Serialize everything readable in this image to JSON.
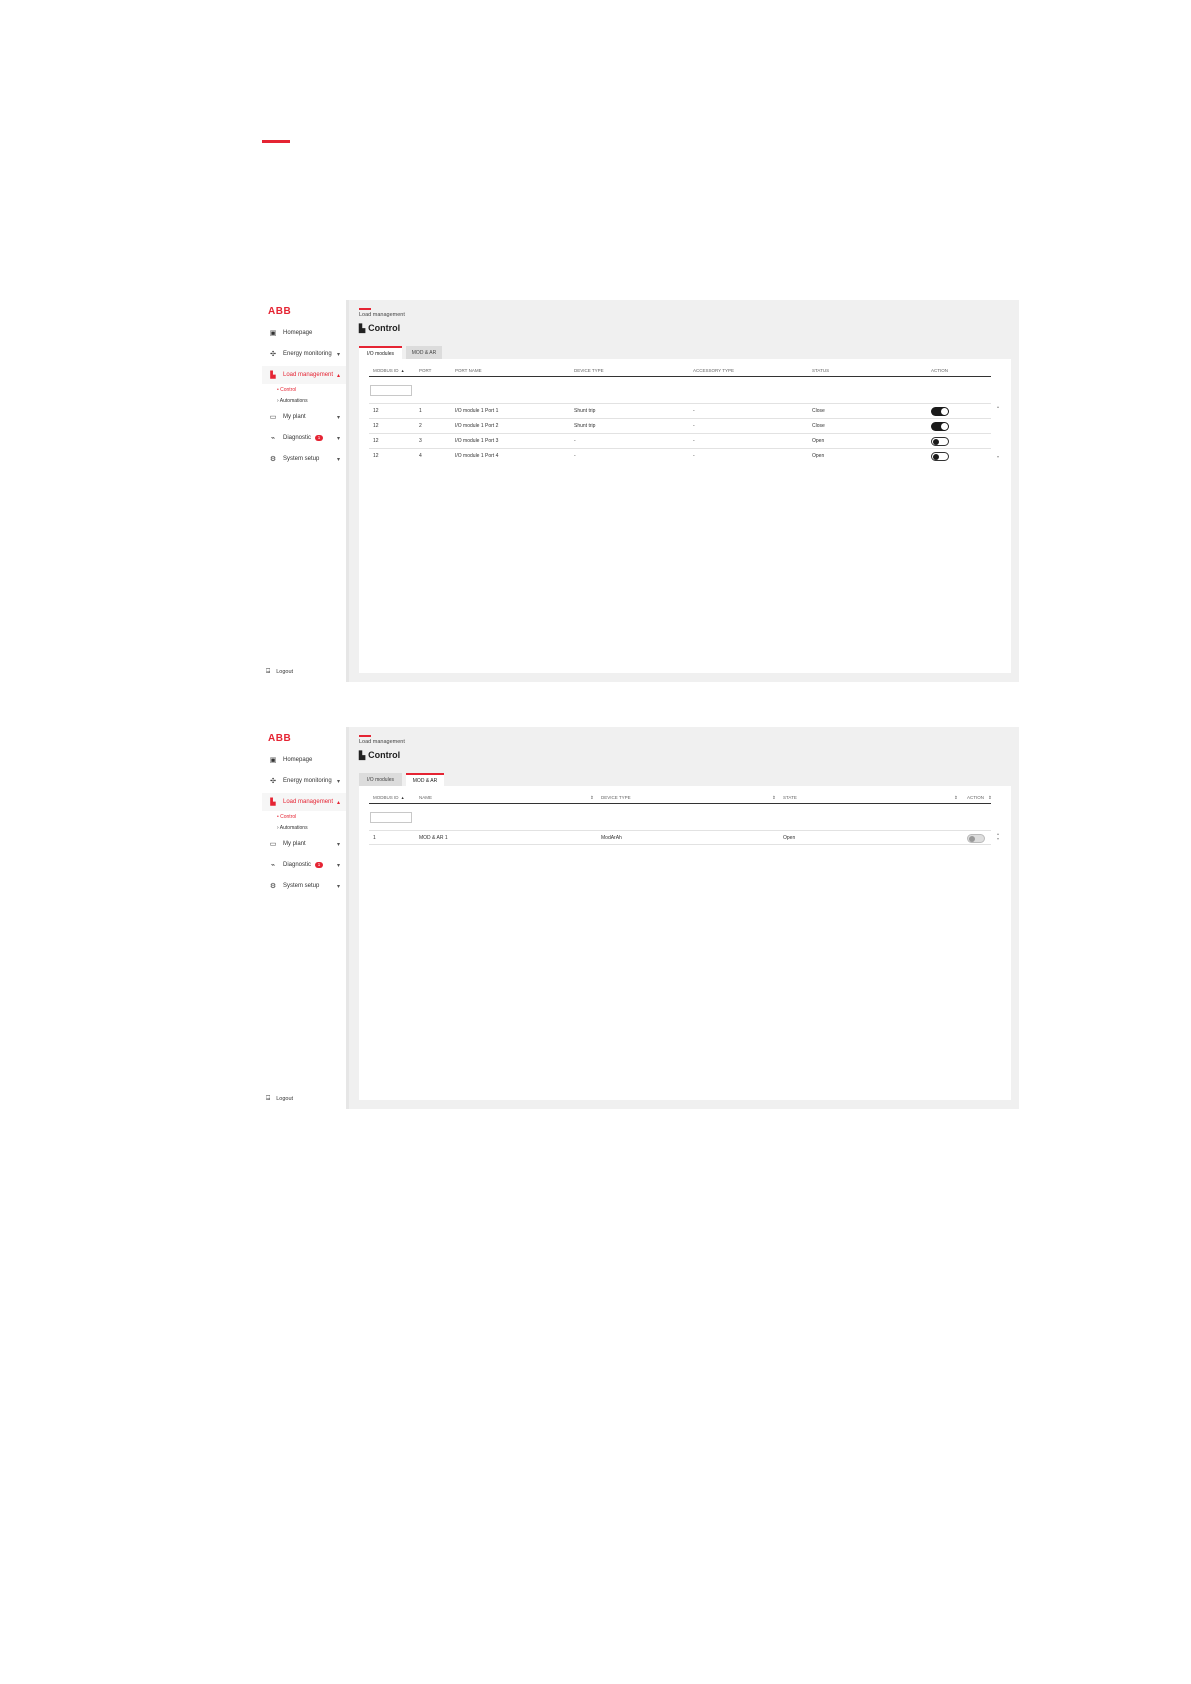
{
  "colors": {
    "accent": "#e52433",
    "sidebar_bg": "#ffffff",
    "content_bg": "#f0f0f0",
    "toggle_on": "#1a1a1a"
  },
  "sidebar": {
    "logo": "ABB",
    "items": [
      {
        "label": "Homepage",
        "icon": "homepage-icon",
        "glyph": "▣"
      },
      {
        "label": "Energy monitoring",
        "icon": "energy-icon",
        "glyph": "✣"
      },
      {
        "label": "Load management",
        "icon": "chart-icon",
        "glyph": "▙"
      },
      {
        "label": "My plant",
        "icon": "monitor-icon",
        "glyph": "▭"
      },
      {
        "label": "Diagnostic",
        "icon": "pulse-icon",
        "glyph": "⌁",
        "badge": "1"
      },
      {
        "label": "System setup",
        "icon": "gear-icon",
        "glyph": "⚙"
      }
    ],
    "sub_items": [
      "• Control",
      "› Automations"
    ],
    "logout": "Logout"
  },
  "screen1": {
    "breadcrumb": "Load management",
    "title": "Control",
    "tabs": [
      "I/O modules",
      "MOD & AR"
    ],
    "columns": [
      "MODBUS ID",
      "PORT",
      "PORT NAME",
      "DEVICE TYPE",
      "ACCESSORY TYPE",
      "STATUS",
      "ACTION"
    ],
    "rows": [
      {
        "modbus_id": "12",
        "port": "1",
        "port_name": "I/O module 1 Port 1",
        "device_type": "Shunt trip",
        "accessory_type": "-",
        "status": "Close",
        "action_on": true
      },
      {
        "modbus_id": "12",
        "port": "2",
        "port_name": "I/O module 1 Port 2",
        "device_type": "Shunt trip",
        "accessory_type": "-",
        "status": "Close",
        "action_on": true
      },
      {
        "modbus_id": "12",
        "port": "3",
        "port_name": "I/O module 1 Port 3",
        "device_type": "-",
        "accessory_type": "-",
        "status": "Open",
        "action_on": false
      },
      {
        "modbus_id": "12",
        "port": "4",
        "port_name": "I/O module 1 Port 4",
        "device_type": "-",
        "accessory_type": "-",
        "status": "Open",
        "action_on": false
      }
    ]
  },
  "screen2": {
    "breadcrumb": "Load management",
    "title": "Control",
    "tabs": [
      "I/O modules",
      "MOD & AR"
    ],
    "columns": [
      "MODBUS ID",
      "NAME",
      "DEVICE TYPE",
      "STATE",
      "ACTION"
    ],
    "rows": [
      {
        "modbus_id": "1",
        "name": "MOD & AR 1",
        "device_type": "ModArAh",
        "state": "Open",
        "action_on": false
      }
    ]
  }
}
